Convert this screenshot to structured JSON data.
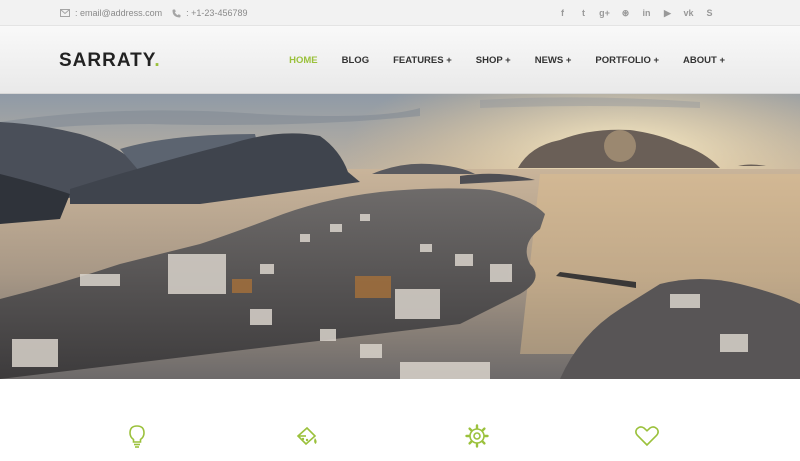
{
  "topbar": {
    "email": ": email@address.com",
    "phone": ": +1-23-456789",
    "social": [
      {
        "icon": "facebook-icon",
        "glyph": "f"
      },
      {
        "icon": "twitter-icon",
        "glyph": "t"
      },
      {
        "icon": "google-plus-icon",
        "glyph": "g+"
      },
      {
        "icon": "dribbble-icon",
        "glyph": "⊛"
      },
      {
        "icon": "linkedin-icon",
        "glyph": "in"
      },
      {
        "icon": "youtube-icon",
        "glyph": "▶"
      },
      {
        "icon": "vk-icon",
        "glyph": "vk"
      },
      {
        "icon": "skype-icon",
        "glyph": "S"
      }
    ]
  },
  "header": {
    "logo": "SARRATY",
    "logo_dot": ".",
    "nav": [
      "HOME",
      "BLOG",
      "FEATURES +",
      "SHOP +",
      "NEWS +",
      "PORTFOLIO +",
      "ABOUT +"
    ]
  },
  "features": {
    "icons": [
      "lightbulb-icon",
      "paint-bucket-icon",
      "gear-icon",
      "heart-icon"
    ]
  },
  "colors": {
    "accent": "#9bc13c",
    "topbar_bg": "#f2f2f2",
    "text_dark": "#333333",
    "text_muted": "#8a8a8a"
  }
}
